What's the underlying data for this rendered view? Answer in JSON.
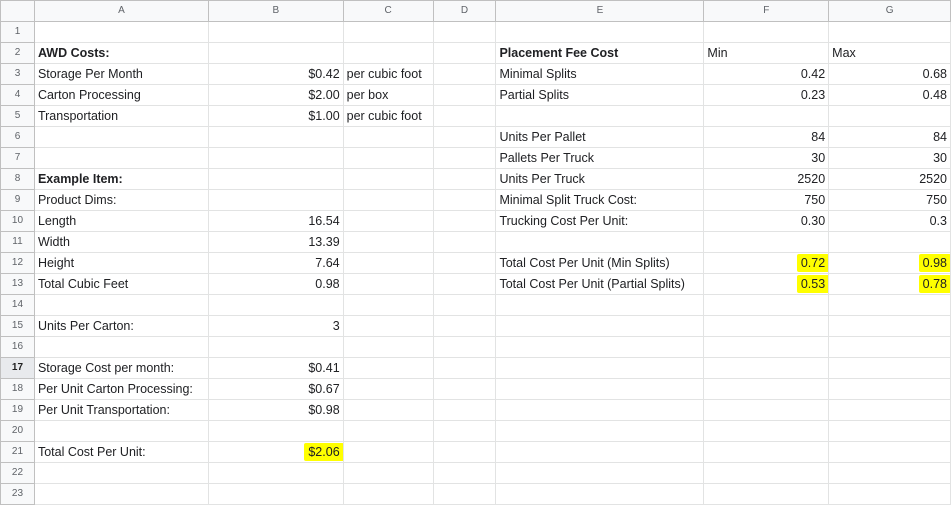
{
  "columns": [
    "A",
    "B",
    "C",
    "D",
    "E",
    "F",
    "G"
  ],
  "rows": [
    "1",
    "2",
    "3",
    "4",
    "5",
    "6",
    "7",
    "8",
    "9",
    "10",
    "11",
    "12",
    "13",
    "14",
    "15",
    "16",
    "17",
    "18",
    "19",
    "20",
    "21",
    "22",
    "23"
  ],
  "awd": {
    "title": "AWD Costs:",
    "storage_label": "Storage Per Month",
    "storage_value": "$0.42",
    "storage_unit": "per cubic foot",
    "carton_label": "Carton Processing",
    "carton_value": "$2.00",
    "carton_unit": "per box",
    "transport_label": "Transportation",
    "transport_value": "$1.00",
    "transport_unit": "per cubic foot"
  },
  "item": {
    "title": "Example Item:",
    "dims_label": "Product Dims:",
    "length_label": "Length",
    "length_value": "16.54",
    "width_label": "Width",
    "width_value": "13.39",
    "height_label": "Height",
    "height_value": "7.64",
    "cubic_label": "Total Cubic Feet",
    "cubic_value": "0.98",
    "units_label": "Units Per Carton:",
    "units_value": "3",
    "storage_cost_label": "Storage Cost per month:",
    "storage_cost_value": "$0.41",
    "carton_cost_label": "Per Unit Carton Processing:",
    "carton_cost_value": "$0.67",
    "transport_cost_label": "Per Unit Transportation:",
    "transport_cost_value": "$0.98",
    "total_label": "Total Cost Per Unit:",
    "total_value": "$2.06"
  },
  "placement": {
    "title": "Placement Fee Cost",
    "min_header": "Min",
    "max_header": "Max",
    "minimal_label": "Minimal Splits",
    "minimal_min": "0.42",
    "minimal_max": "0.68",
    "partial_label": "Partial Splits",
    "partial_min": "0.23",
    "partial_max": "0.48",
    "upp_label": "Units Per Pallet",
    "upp_min": "84",
    "upp_max": "84",
    "ppt_label": "Pallets Per Truck",
    "ppt_min": "30",
    "ppt_max": "30",
    "upt_label": "Units Per Truck",
    "upt_min": "2520",
    "upt_max": "2520",
    "truck_cost_label": "Minimal Split Truck Cost:",
    "truck_cost_min": "750",
    "truck_cost_max": "750",
    "trucking_unit_label": "Trucking Cost Per Unit:",
    "trucking_unit_min": "0.30",
    "trucking_unit_max": "0.3",
    "total_min_label": "Total Cost Per Unit (Min Splits)",
    "total_min_min": "0.72",
    "total_min_max": "0.98",
    "total_partial_label": "Total Cost Per Unit (Partial Splits)",
    "total_partial_min": "0.53",
    "total_partial_max": "0.78"
  },
  "highlight_color": "#ffff00"
}
